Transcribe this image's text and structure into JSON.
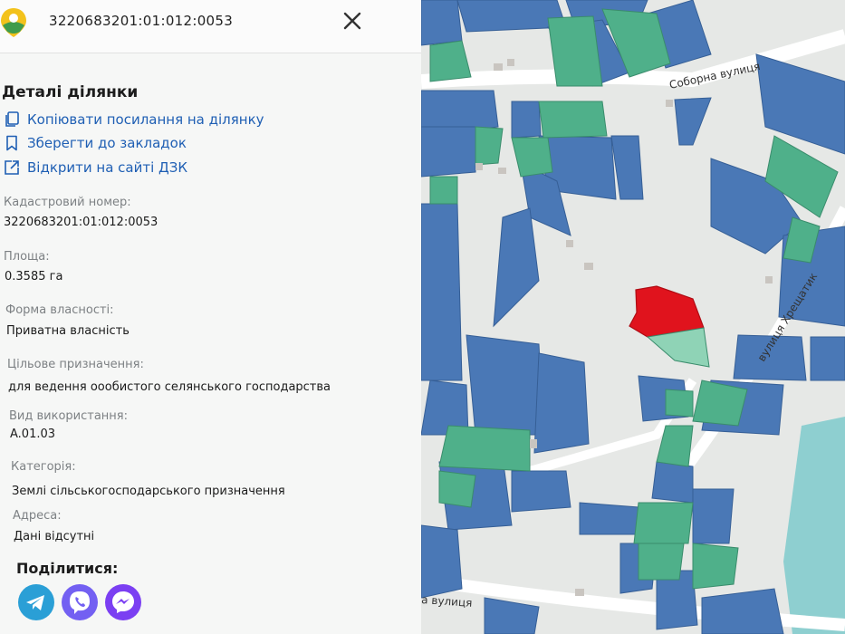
{
  "header": {
    "cadastral_title": "3220683201:01:012:0053",
    "logo_icon": "map-pin-logo-icon",
    "close_icon": "close-icon"
  },
  "details": {
    "title": "Деталі ділянки",
    "actions": [
      {
        "label": "Копіювати посилання на ділянку",
        "icon": "copy-icon"
      },
      {
        "label": "Зберегти до закладок",
        "icon": "bookmark-icon"
      },
      {
        "label": "Відкрити на сайті ДЗК",
        "icon": "external-link-icon"
      }
    ],
    "fields": [
      {
        "label": "Кадастровий номер:",
        "value": "3220683201:01:012:0053"
      },
      {
        "label": "Площа:",
        "value": "0.3585 га"
      },
      {
        "label": "Форма власності:",
        "value": "Приватна власність"
      },
      {
        "label": "Цільове призначення:",
        "value": "для ведення оообистого селянського господарства"
      },
      {
        "label": "Вид використання:",
        "value": "A.01.03"
      },
      {
        "label": "Категорія:",
        "value": "Землі сільськогосподарського призначення"
      },
      {
        "label": "Адреса:",
        "value": "Дані відсутні"
      }
    ]
  },
  "share": {
    "title": "Поділитися:",
    "buttons": [
      {
        "name": "telegram",
        "icon": "telegram-icon",
        "color": "#2a9fd6"
      },
      {
        "name": "viber",
        "icon": "viber-icon",
        "color": "#7360f2"
      },
      {
        "name": "messenger",
        "icon": "messenger-icon",
        "color": "#7b3ff2"
      }
    ]
  },
  "map": {
    "street_labels": [
      "Соборна вулиця",
      "вулиця Хрещатик",
      "а вулиця"
    ],
    "colors": {
      "private_parcel": "#4a78b6",
      "agri_parcel": "#4fb08a",
      "selected_parcel": "#e0131d",
      "water": "#8ecfd0",
      "road": "#ffffff",
      "background": "#e6e8e6"
    }
  }
}
